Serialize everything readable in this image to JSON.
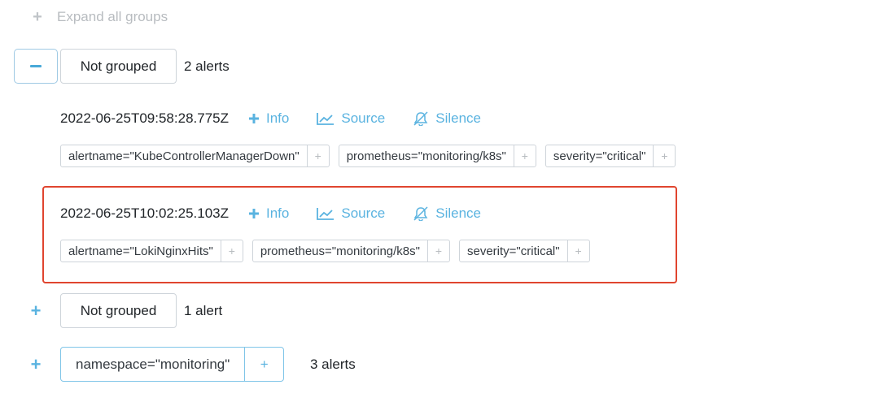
{
  "toolbar": {
    "expand_all_label": "Expand all groups"
  },
  "groups": [
    {
      "label": "Not grouped",
      "count": "2 alerts",
      "alerts": [
        {
          "timestamp": "2022-06-25T09:58:28.775Z",
          "info_label": "Info",
          "source_label": "Source",
          "silence_label": "Silence",
          "labels": [
            "alertname=\"KubeControllerManagerDown\"",
            "prometheus=\"monitoring/k8s\"",
            "severity=\"critical\""
          ]
        },
        {
          "timestamp": "2022-06-25T10:02:25.103Z",
          "info_label": "Info",
          "source_label": "Source",
          "silence_label": "Silence",
          "labels": [
            "alertname=\"LokiNginxHits\"",
            "prometheus=\"monitoring/k8s\"",
            "severity=\"critical\""
          ]
        }
      ]
    },
    {
      "label": "Not grouped",
      "count": "1 alert"
    },
    {
      "label": "namespace=\"monitoring\"",
      "count": "3 alerts"
    }
  ],
  "label_add_symbol": "+",
  "colors": {
    "accent": "#5ab3e0",
    "highlight": "#e0452f",
    "border": "#ced4da"
  }
}
